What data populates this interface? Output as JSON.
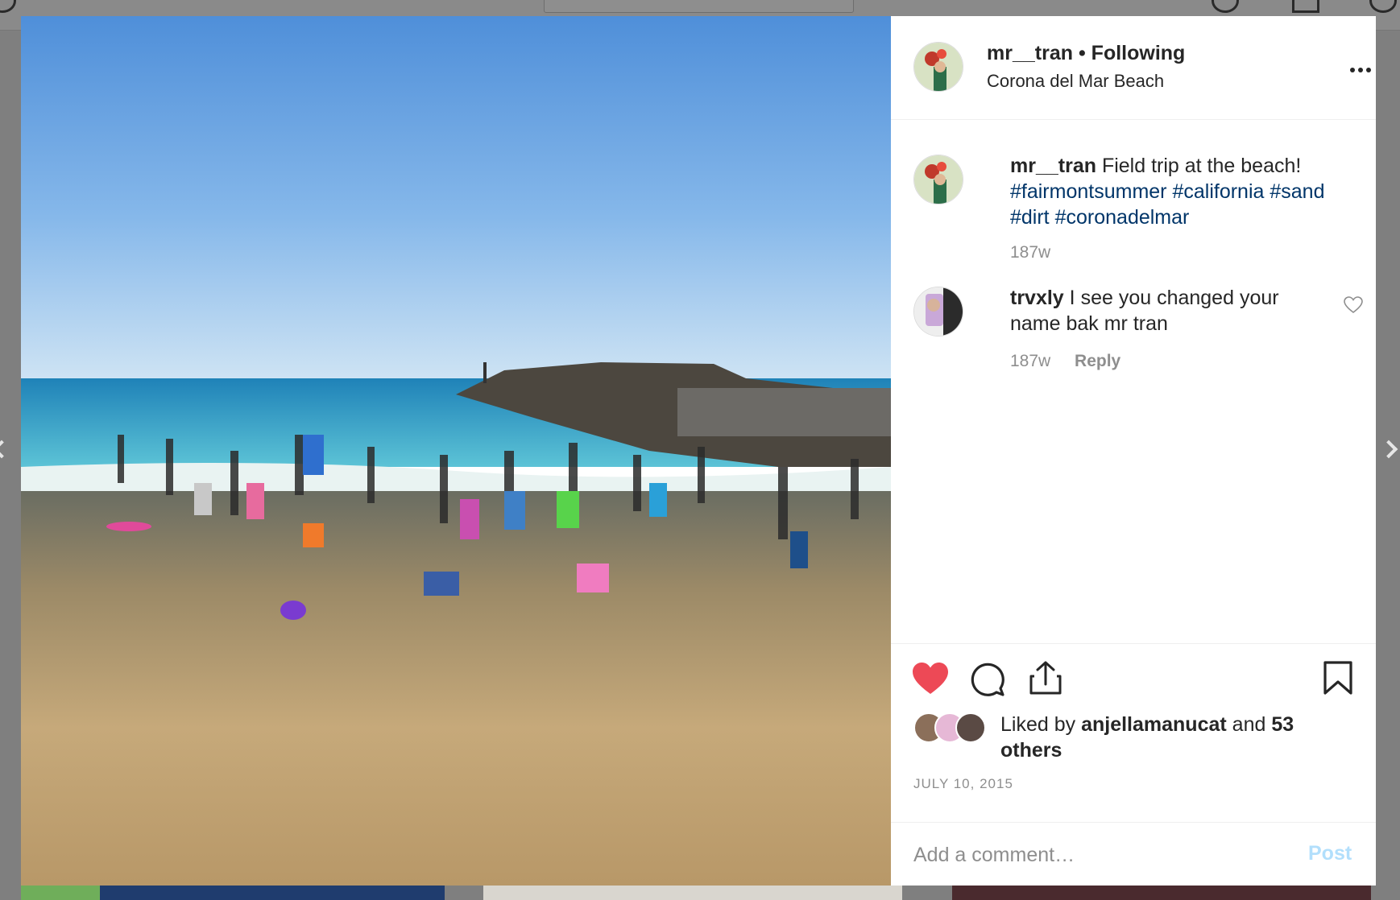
{
  "post": {
    "username": "mr__tran",
    "separator": "•",
    "follow_state": "Following",
    "location": "Corona del Mar Beach",
    "photo_alt": "Children playing at the beach"
  },
  "caption": {
    "username": "mr__tran",
    "text": "Field trip at the beach!",
    "hashtags": [
      "#fairmontsummer",
      "#california",
      "#sand",
      "#dirt",
      "#coronadelmar"
    ],
    "age": "187w"
  },
  "comments": [
    {
      "username": "trvxly",
      "text": "I see you changed your name bak mr tran",
      "age": "187w",
      "reply_label": "Reply"
    }
  ],
  "likes": {
    "prefix": "Liked by",
    "top_liker": "anjellamanucat",
    "conjunction": "and",
    "others": "53 others",
    "liked": true
  },
  "date": "JULY 10, 2015",
  "add_comment": {
    "placeholder": "Add a comment…",
    "post_label": "Post"
  },
  "colors": {
    "heart_liked": "#ed4956",
    "hashtag": "#003569",
    "muted": "#8e8e8e",
    "post_disabled": "#b2dffc"
  },
  "icons": [
    "more-options-icon",
    "heart-icon",
    "comment-icon",
    "share-icon",
    "bookmark-icon",
    "comment-like-icon"
  ]
}
